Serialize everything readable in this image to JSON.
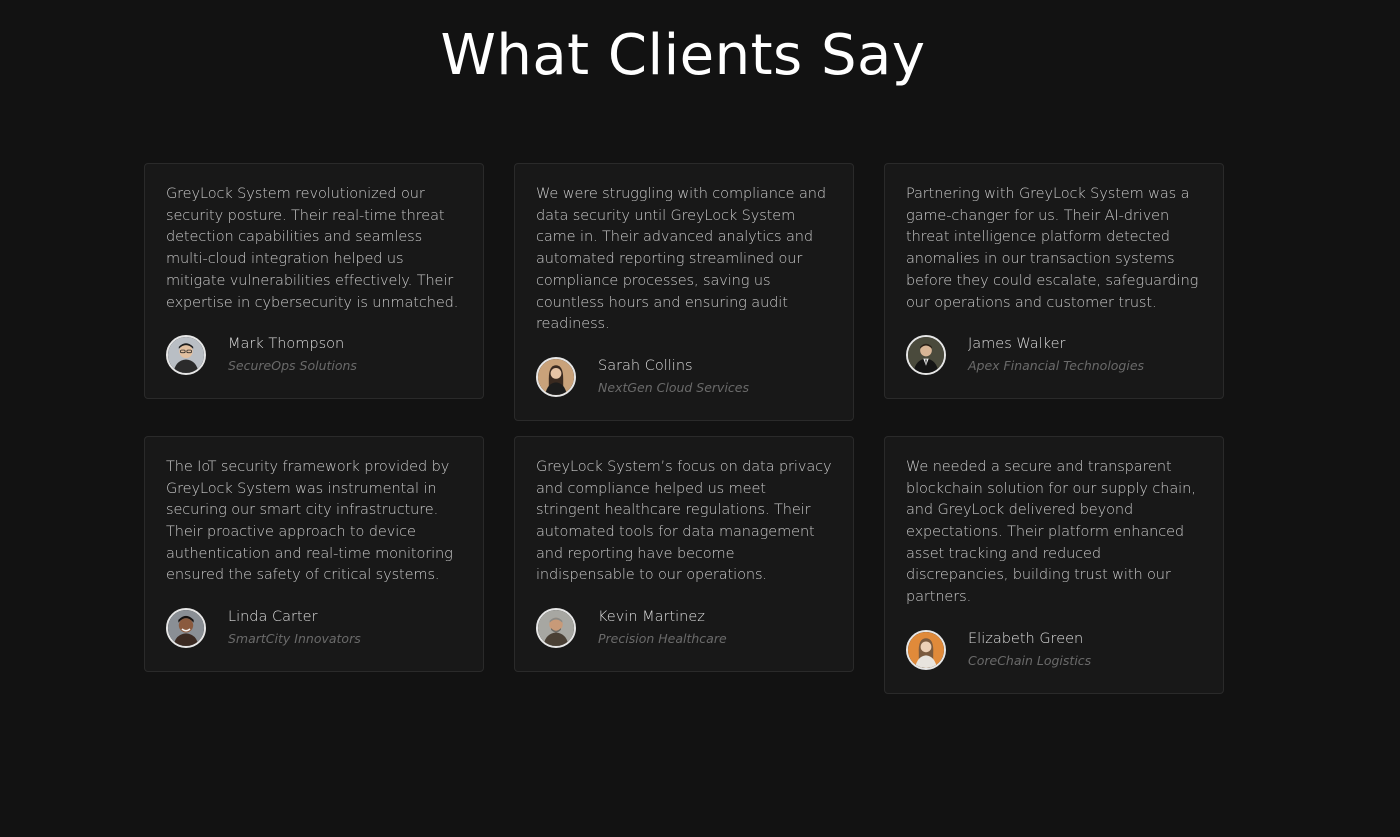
{
  "page": {
    "title": "What Clients Say"
  },
  "testimonials": [
    {
      "quote": "GreyLock System revolutionized our security posture. Their real-time threat detection capabilities and seamless multi-cloud integration helped us mitigate vulnerabilities effectively. Their expertise in cybersecurity is unmatched.",
      "name": "Mark Thompson",
      "company": "SecureOps Solutions",
      "avatar_bg": "#b9bec4",
      "avatar_fg": "#2b2b2b"
    },
    {
      "quote": "We were struggling with compliance and data security until GreyLock System came in. Their advanced analytics and automated reporting streamlined our compliance processes, saving us countless hours and ensuring audit readiness.",
      "name": "Sarah Collins",
      "company": "NextGen Cloud Services",
      "avatar_bg": "#c9a27a",
      "avatar_fg": "#3a2a20"
    },
    {
      "quote": "Partnering with GreyLock System was a game-changer for us. Their AI-driven threat intelligence platform detected anomalies in our transaction systems before they could escalate, safeguarding our operations and customer trust.",
      "name": "James Walker",
      "company": "Apex Financial Technologies",
      "avatar_bg": "#4a4a3c",
      "avatar_fg": "#1a1a1a"
    },
    {
      "quote": "The IoT security framework provided by GreyLock System was instrumental in securing our smart city infrastructure. Their proactive approach to device authentication and real-time monitoring ensured the safety of critical systems.",
      "name": "Linda Carter",
      "company": "SmartCity Innovators",
      "avatar_bg": "#8a8f95",
      "avatar_fg": "#3b2a22"
    },
    {
      "quote": "GreyLock System’s focus on data privacy and compliance helped us meet stringent healthcare regulations. Their automated tools for data management and reporting have become indispensable to our operations.",
      "name": "Kevin Martinez",
      "company": "Precision Healthcare",
      "avatar_bg": "#a7a7a2",
      "avatar_fg": "#4a4035"
    },
    {
      "quote": "We needed a secure and transparent blockchain solution for our supply chain, and GreyLock delivered beyond expectations. Their platform enhanced asset tracking and reduced discrepancies, building trust with our partners.",
      "name": "Elizabeth Green",
      "company": "CoreChain Logistics",
      "avatar_bg": "#e08a3a",
      "avatar_fg": "#6b4a30"
    }
  ],
  "colors": {
    "background": "#121212",
    "card_background": "#181818",
    "card_border": "#2a2a2a",
    "title": "#ffffff",
    "quote_text": "#c9c9c9",
    "company_text": "#6a6a6a"
  }
}
